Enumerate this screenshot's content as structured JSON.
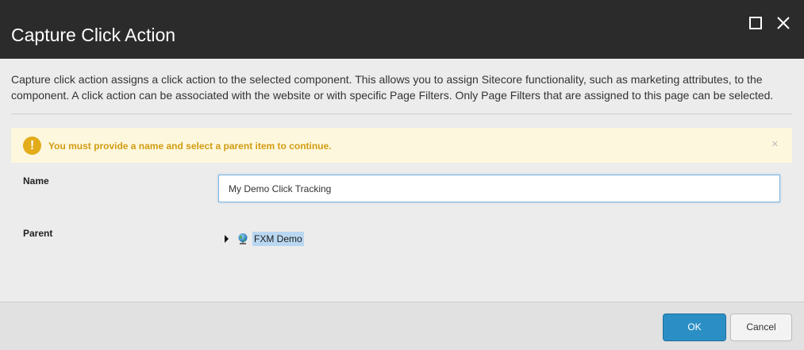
{
  "dialog": {
    "title": "Capture Click Action",
    "description": "Capture click action assigns a click action to the selected component. This allows you to assign Sitecore functionality, such as marketing attributes, to the component. A click action can be associated with the website or with specific Page Filters. Only Page Filters that are assigned to this page can be selected.",
    "icons": {
      "maximize": "maximize-icon",
      "close": "close-icon"
    }
  },
  "warning": {
    "icon_glyph": "!",
    "message": "You must provide a name and select a parent item to continue.",
    "close_glyph": "×",
    "color": "#d39c12",
    "background": "#fdf8dd"
  },
  "form": {
    "name_label": "Name",
    "name_value": "My Demo Click Tracking",
    "parent_label": "Parent",
    "tree": [
      {
        "label": "FXM Demo",
        "icon": "globe-icon",
        "selected": true,
        "expandable": true
      }
    ]
  },
  "footer": {
    "ok_label": "OK",
    "cancel_label": "Cancel"
  },
  "colors": {
    "header_bg": "#2b2b2b",
    "accent": "#2b8fc5",
    "selection": "#b9d7f1"
  }
}
